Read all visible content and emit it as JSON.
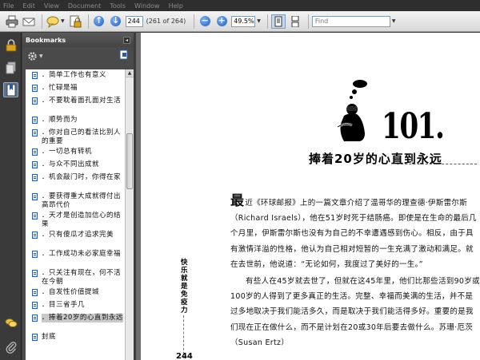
{
  "menu": [
    "File",
    "Edit",
    "View",
    "Document",
    "Tools",
    "Window",
    "Help"
  ],
  "toolbar": {
    "page_value": "244",
    "page_of": "(261 of 264)",
    "zoom_value": "49.5%",
    "find_placeholder": "Find"
  },
  "left_icons": [
    "lock-icon",
    "pages-icon",
    "bookmarks-icon",
    "comments-icon",
    "attachment-icon"
  ],
  "bookmarks": {
    "title": "Bookmarks",
    "items": [
      {
        "label": "．简单工作也有意义"
      },
      {
        "label": "．忙碌是福"
      },
      {
        "label": "．不要耽着面孔面对生活"
      },
      {
        "label": "．顺势而为"
      },
      {
        "label": "．你对自己的看法比别人的重要"
      },
      {
        "label": "．一切总有转机"
      },
      {
        "label": "．与众不同出成就"
      },
      {
        "label": "．机会敲门时，你得在家"
      },
      {
        "label": "．要获得重大成就得付出高昂代价"
      },
      {
        "label": "．天才是创造加信心的结果"
      },
      {
        "label": "．只有傻瓜才追求完美"
      },
      {
        "label": "．工作成功未必家庭幸福"
      },
      {
        "label": "．只关注有现在，何不活在今朝"
      },
      {
        "label": "．自发性价值提城"
      },
      {
        "label": "．目三省手几"
      },
      {
        "label": "．捧着20岁的心直到永远"
      },
      {
        "label": "封底"
      }
    ],
    "selected_index": 15
  },
  "document": {
    "chapter_number": "101.",
    "chapter_title": "捧着20岁的心直到永远",
    "side_text": "快乐就是免疫力",
    "page_number": "244",
    "dropcap": "最",
    "paragraphs": [
      "近《环球邮报》上的一篇文章介绍了温哥华的理查德·伊斯雷尔斯（Richard Israels），他在51岁时死于结肠癌。即使是在生命的最后几个月里，伊斯雷尔斯也没有为自己的不幸遭遇感到伤心。相反，由于具有激情洋溢的性格，他认为自己相对短暂的一生充满了激动和满足。就在去世前，他说道：“无论如何，我度过了美好的一生。”",
      "有些人在45岁就去世了，但就在这45年里，他们比那些活到90岁或100岁的人得到了更多真正的生活。完整、幸福而美满的生活，并不是过多地取决于我们能活多久，而是取决于我们能活得多好。重要的是我们现在正在做什么，而不是计划在20或30年后要去做什么。苏珊·厄茨（Susan Ertz）"
    ]
  }
}
